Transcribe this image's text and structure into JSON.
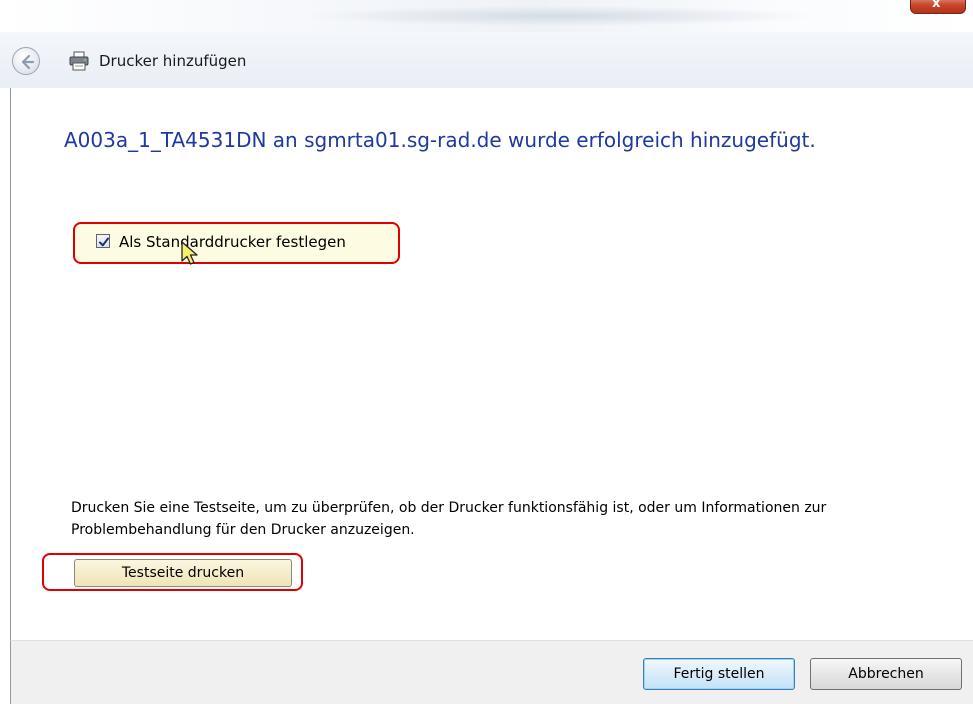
{
  "window": {
    "title": "Drucker hinzufügen",
    "close_label": "x",
    "back_icon": "back-arrow-icon",
    "printer_icon": "printer-icon"
  },
  "main": {
    "heading": "A003a_1_TA4531DN an sgmrta01.sg-rad.de wurde erfolgreich hinzugefügt.",
    "default_printer_checkbox": {
      "label": "Als Standarddrucker festlegen",
      "checked": true
    },
    "info_text": "Drucken Sie eine Testseite, um zu überprüfen, ob der Drucker funktionsfähig ist, oder um Informationen zur Problembehandlung für den Drucker anzuzeigen.",
    "test_page_button": "Testseite drucken"
  },
  "footer": {
    "finish_button": "Fertig stellen",
    "cancel_button": "Abbrechen"
  },
  "colors": {
    "heading": "#1e3a9e",
    "highlight_border": "#e00000",
    "highlight_fill": "#fdfbe2",
    "primary_button_border": "#3c7fb1"
  }
}
